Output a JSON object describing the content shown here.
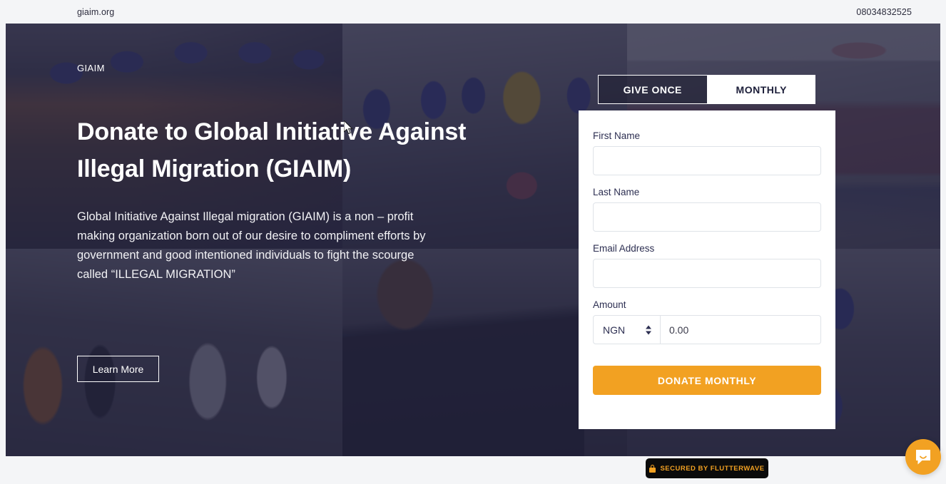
{
  "topbar": {
    "url": "giaim.org",
    "phone": "08034832525"
  },
  "hero": {
    "eyebrow": "GIAIM",
    "title": "Donate to Global Initiative Against Illegal Migration (GIAIM)",
    "subtitle": "Global Initiative Against Illegal migration (GIAIM) is a non – profit making organization born out of our desire to compliment efforts by government and good intentioned individuals to fight the scourge called “ILLEGAL MIGRATION”",
    "learn_more_label": "Learn More"
  },
  "donation": {
    "tabs": [
      {
        "label": "GIVE ONCE",
        "active": true
      },
      {
        "label": "MONTHLY",
        "active": false
      }
    ],
    "fields": [
      {
        "label": "First Name",
        "value": "",
        "placeholder": ""
      },
      {
        "label": "Last Name",
        "value": "",
        "placeholder": ""
      },
      {
        "label": "Email Address",
        "value": "",
        "placeholder": ""
      }
    ],
    "amount": {
      "label": "Amount",
      "currency": "NGN",
      "value": "0.00"
    },
    "submit_label": "DONATE MONTHLY",
    "accent_color": "#f2a122"
  },
  "footer": {
    "secured_badge": "SECURED BY FLUTTERWAVE",
    "badge_bg": "#0b0b0b",
    "badge_text_color": "#f2a122"
  },
  "chat": {
    "launcher_color": "#f2a122"
  }
}
